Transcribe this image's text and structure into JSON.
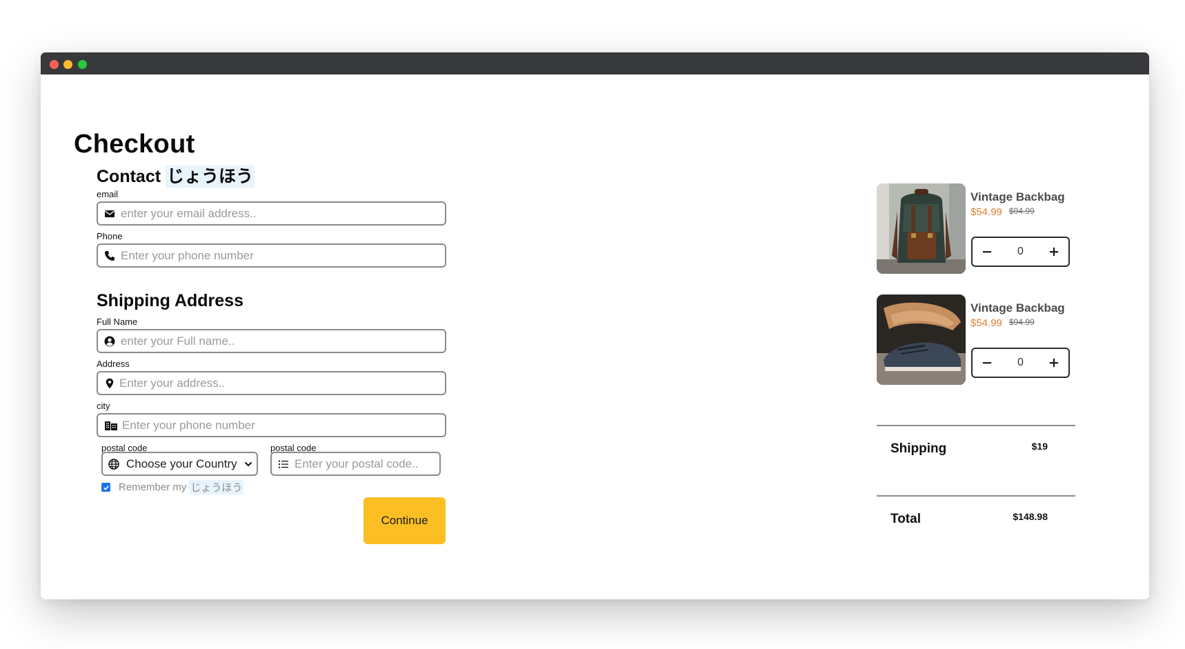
{
  "page": {
    "title": "Checkout"
  },
  "contact": {
    "heading_text": "Contact ",
    "heading_highlight": "じょうほう",
    "email": {
      "label": "email",
      "placeholder": "enter your email address.."
    },
    "phone": {
      "label": "Phone",
      "placeholder": "Enter your phone number"
    }
  },
  "shipping": {
    "heading": "Shipping Address",
    "full_name": {
      "label": "Full Name",
      "placeholder": "enter your Full name.."
    },
    "address": {
      "label": "Address",
      "placeholder": "Enter your address.."
    },
    "city": {
      "label": "city",
      "placeholder": "Enter your phone number"
    },
    "country": {
      "label": "postal code",
      "selected": "Choose your Country"
    },
    "postal": {
      "label": "postal code",
      "placeholder": "Enter your postal code.."
    },
    "remember_text": "Remember my",
    "remember_highlight": "じょうほう",
    "remember_checked": true
  },
  "actions": {
    "continue_label": "Continue"
  },
  "cart": {
    "items": [
      {
        "name": "Vintage Backbag",
        "price": "$54.99",
        "old_price": "$94.99",
        "quantity": "0",
        "image": "backpack-photo"
      },
      {
        "name": "Vintage Backbag",
        "price": "$54.99",
        "old_price": "$94.99",
        "quantity": "0",
        "image": "shoes-photo"
      }
    ],
    "shipping_label": "Shipping",
    "shipping_value": "$19",
    "total_label": "Total",
    "total_value": "$148.98"
  },
  "icons": {
    "email": "envelope-icon",
    "phone": "phone-icon",
    "full_name": "user-circle-icon",
    "address": "map-pin-icon",
    "city": "city-icon",
    "country": "globe-icon",
    "postal": "list-icon",
    "minus": "minus-icon",
    "plus": "plus-icon"
  },
  "colors": {
    "accent_button": "#fbbf24",
    "price": "#e07f2e",
    "checkbox": "#1a73e8",
    "titlebar": "#37393c"
  }
}
